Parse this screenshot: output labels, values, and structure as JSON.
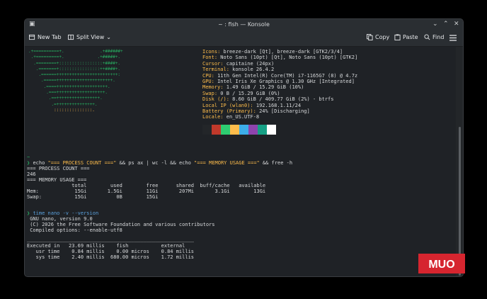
{
  "window": {
    "title": "~ : fish — Konsole",
    "min_icon": "⌄",
    "max_icon": "⌃",
    "close_icon": "✕",
    "app_icon": "terminal-icon"
  },
  "toolbar": {
    "new_tab": "New Tab",
    "split_view": "Split View",
    "split_view_chevron": "⌄",
    "copy": "Copy",
    "paste": "Paste",
    "find": "Find"
  },
  "colors": {
    "background": "#1f2226",
    "accent": "#fdbc4b",
    "green": "#27ae60",
    "muo_red": "#d6252f"
  },
  "fastfetch": {
    "ascii_logo": [
      ".+==========+.              .+######+",
      " .+=========+.             .+#####+.",
      "  .========+:::::::::::::::::+####+.",
      "   .=======+::::::::::::::::++####+.",
      "    .======++++++++++++++++++++++++:",
      "     .=====++++++++++++++++++++++.",
      "      .====++++++++++++++++++++.",
      "       .===+++++++++++++++++++.",
      "        .==+++++++++++++++++.",
      "         .=+++++++++++++++.",
      "          :::::::::::::::."
    ],
    "info": [
      {
        "key": "Icons:",
        "val": " breeze-dark [Qt], breeze-dark [GTK2/3/4]"
      },
      {
        "key": "Font:",
        "val": " Noto Sans (10pt) [Qt], Noto Sans (10pt) [GTK2]"
      },
      {
        "key": "Cursor:",
        "val": " capitaine (24px)"
      },
      {
        "key": "Terminal:",
        "val": " konsole 26.4.2"
      },
      {
        "key": "CPU:",
        "val": " 11th Gen Intel(R) Core(TM) i7-1165G7 (8) @ 4.7z"
      },
      {
        "key": "GPU:",
        "val": " Intel Iris Xe Graphics @ 1.30 GHz [Integrated]"
      },
      {
        "key": "Memory:",
        "val": " 1.49 GiB / 15.29 GiB (10%)"
      },
      {
        "key": "Swap:",
        "val": " 0 B / 15.29 GiB (0%)"
      },
      {
        "key": "Disk (/):",
        "val": " 8.60 GiB / 409.77 GiB (2%) - btrfs"
      },
      {
        "key": "Local IP (wlan0):",
        "val": " 192.168.1.11/24"
      },
      {
        "key": "Battery (Primary):",
        "val": " 24% [Discharging]"
      },
      {
        "key": "Locale:",
        "val": " en_US.UTF-8"
      }
    ],
    "swatches": [
      "#232629",
      "#c0392b",
      "#2ecc71",
      "#fdbc4b",
      "#3daee9",
      "#8e44ad",
      "#16a085",
      "#ffffff"
    ]
  },
  "terminal": {
    "prompt1": "~",
    "cmd1_a": "echo ",
    "cmd1_s1": "\"=== PROCESS COUNT ===\"",
    "cmd1_b": " && ps ax | wc -l && echo ",
    "cmd1_s2": "\"=== MEMORY USAGE ===\"",
    "cmd1_c": " && free -h",
    "out1": "=== PROCESS COUNT ===",
    "out2": "246",
    "out3": "=== MEMORY USAGE ===",
    "out4": "               total        used        free      shared  buff/cache   available",
    "out5": "Mem:            15Gi       1.5Gi        11Gi       207Mi       3.1Gi        13Gi",
    "out6": "Swap:           15Gi          0B        15Gi",
    "cmd2": "time nano -v --version",
    "out7": " GNU nano, version 9.0",
    "out8": " (C) 2026 the Free Software Foundation and various contributors",
    "out9": " Compiled options: --enable-utf8",
    "out10": "________________________________________________________",
    "out11": "Executed in   23.69 millis    fish           external",
    "out12": "   usr time    0.84 millis    0.00 micros    0.84 millis",
    "out13": "   sys time    2.40 millis  680.00 micros    1.72 millis"
  },
  "watermark": {
    "text": "MUO"
  }
}
